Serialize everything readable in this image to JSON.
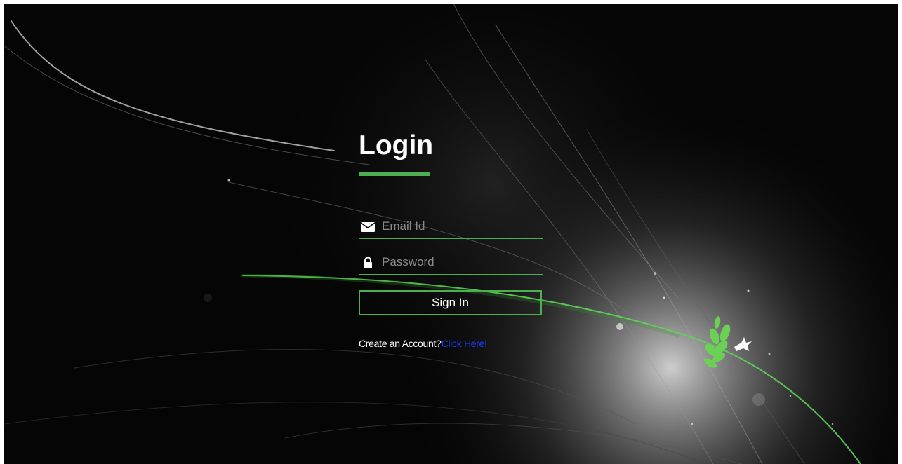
{
  "login": {
    "title": "Login",
    "email_placeholder": "Email Id",
    "password_placeholder": "Password",
    "signin_label": "Sign In",
    "create_prompt": "Create an Account?",
    "create_link": "Click Here!"
  },
  "icons": {
    "email": "envelope-icon",
    "password": "lock-icon"
  },
  "colors": {
    "background": "#050505",
    "accent": "#4caf50",
    "link": "#1a3cff",
    "text": "#ffffff"
  }
}
